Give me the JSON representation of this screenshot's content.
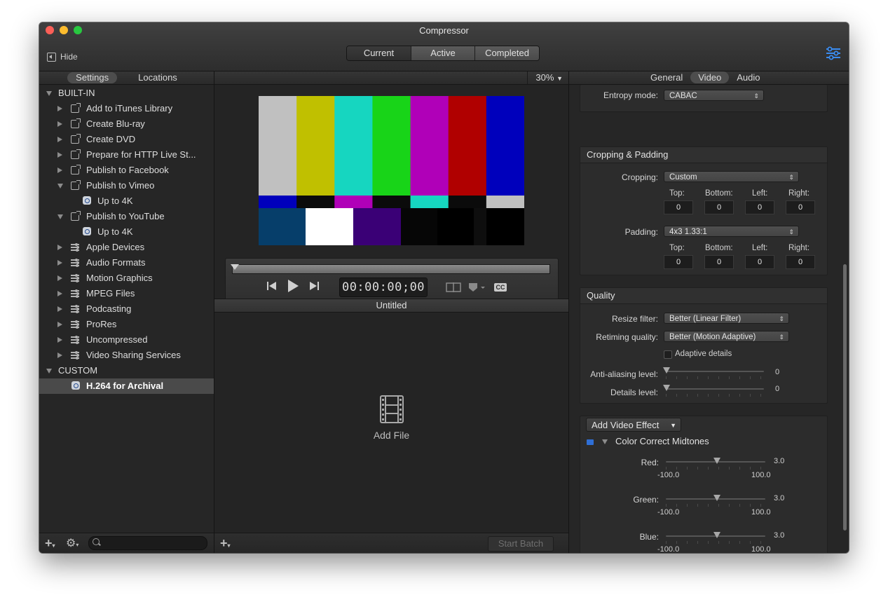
{
  "window": {
    "title": "Compressor",
    "hide_label": "Hide"
  },
  "top_tabs": [
    {
      "label": "Current",
      "width": 91
    },
    {
      "label": "Active",
      "width": 90
    },
    {
      "label": "Completed",
      "width": 91
    }
  ],
  "left": {
    "tabs": [
      "Settings",
      "Locations"
    ],
    "builtin_label": "BUILT-IN",
    "custom_label": "CUSTOM",
    "items": [
      {
        "label": "Add to iTunes Library"
      },
      {
        "label": "Create Blu-ray"
      },
      {
        "label": "Create DVD"
      },
      {
        "label": "Prepare for HTTP Live St..."
      },
      {
        "label": "Publish to Facebook"
      },
      {
        "label": "Publish to Vimeo"
      },
      {
        "label": "Up to 4K"
      },
      {
        "label": "Publish to YouTube"
      },
      {
        "label": "Up to 4K"
      },
      {
        "label": "Apple Devices"
      },
      {
        "label": "Audio Formats"
      },
      {
        "label": "Motion Graphics"
      },
      {
        "label": "MPEG Files"
      },
      {
        "label": "Podcasting"
      },
      {
        "label": "ProRes"
      },
      {
        "label": "Uncompressed"
      },
      {
        "label": "Video Sharing Services"
      }
    ],
    "custom_item": "H.264 for Archival"
  },
  "viewer": {
    "zoom": "30%",
    "timecode": "00:00:00;00",
    "cc_label": "CC",
    "batch_title": "Untitled",
    "add_file": "Add File",
    "start_batch": "Start Batch",
    "color_bars": {
      "top": [
        "#c0c0c0",
        "#c0c000",
        "#16d6c0",
        "#18d418",
        "#b000b8",
        "#b00000",
        "#0000bc"
      ],
      "mid": [
        "#0000bc",
        "#0b0b0b",
        "#b000b8",
        "#0b0b0b",
        "#16d6c0",
        "#0b0b0b",
        "#c0c0c0"
      ],
      "bottom": [
        "#063e6a",
        "#ffffff",
        "#3a0076",
        "#060606",
        "#000000",
        "#0e0e0e",
        "#000000"
      ]
    }
  },
  "inspector": {
    "tabs": [
      "General",
      "Video",
      "Audio"
    ],
    "entropy": {
      "label": "Entropy mode:",
      "value": "CABAC"
    },
    "cropping": {
      "title": "Cropping & Padding",
      "cropping_label": "Cropping:",
      "cropping_value": "Custom",
      "padding_label": "Padding:",
      "padding_value": "4x3 1.33:1",
      "cols": [
        "Top:",
        "Bottom:",
        "Left:",
        "Right:"
      ],
      "crop_vals": [
        "0",
        "0",
        "0",
        "0"
      ],
      "pad_vals": [
        "0",
        "0",
        "0",
        "0"
      ]
    },
    "quality": {
      "title": "Quality",
      "resize_label": "Resize filter:",
      "resize_value": "Better (Linear Filter)",
      "retime_label": "Retiming quality:",
      "retime_value": "Better (Motion Adaptive)",
      "adaptive_label": "Adaptive details",
      "antialias_label": "Anti-aliasing level:",
      "antialias_value": "0",
      "details_label": "Details level:",
      "details_value": "0"
    },
    "effect": {
      "add_label": "Add Video Effect",
      "name": "Color Correct Midtones",
      "min_label": "-100.0",
      "max_label": "100.0",
      "sliders": [
        {
          "label": "Red:",
          "value": "3.0",
          "min": -100,
          "max": 100,
          "v": 3
        },
        {
          "label": "Green:",
          "value": "3.0",
          "min": -100,
          "max": 100,
          "v": 3
        },
        {
          "label": "Blue:",
          "value": "3.0",
          "min": -100,
          "max": 100,
          "v": 3
        }
      ]
    }
  }
}
